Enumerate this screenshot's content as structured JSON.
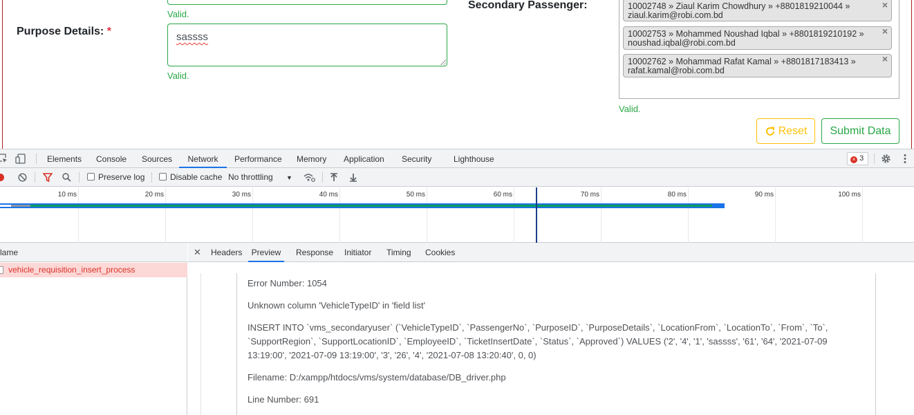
{
  "form": {
    "valid_text": "Valid.",
    "purpose_label": "Purpose Details:",
    "required_mark": "*",
    "purpose_value": "sassss",
    "secondary_label": "Secondary Passenger:",
    "passengers": [
      {
        "line1": "10002748 » Ziaul Karim Chowdhury » +8801819210044 »",
        "line2": "ziaul.karim@robi.com.bd",
        "remove": "×"
      },
      {
        "line1": "10002753 » Mohammed Noushad Iqbal » +8801819210192 »",
        "line2": "noushad.iqbal@robi.com.bd",
        "remove": "×"
      },
      {
        "line1": "10002762 » Mohammad Rafat Kamal » +8801817183413 »",
        "line2": "rafat.kamal@robi.com.bd",
        "remove": "×"
      }
    ],
    "reset_label": "Reset",
    "submit_label": "Submit Data",
    "colors": {
      "valid": "#28a745",
      "reset": "#ffc107",
      "required": "#dc3545"
    }
  },
  "devtools": {
    "tabs": [
      "Elements",
      "Console",
      "Sources",
      "Network",
      "Performance",
      "Memory",
      "Application",
      "Security",
      "Lighthouse"
    ],
    "active_tab": "Network",
    "error_count": "3",
    "toolbar": {
      "preserve_log": "Preserve log",
      "disable_cache": "Disable cache",
      "throttling": "No throttling"
    },
    "timeline_ticks": [
      "10 ms",
      "20 ms",
      "30 ms",
      "40 ms",
      "50 ms",
      "60 ms",
      "70 ms",
      "80 ms",
      "90 ms",
      "100 ms"
    ],
    "request_list": {
      "header": "lame",
      "rows": [
        "vehicle_requisition_insert_process"
      ]
    },
    "detail_tabs": [
      "Headers",
      "Preview",
      "Response",
      "Initiator",
      "Timing",
      "Cookies"
    ],
    "active_detail_tab": "Preview",
    "preview": {
      "error_number": "Error Number: 1054",
      "message": "Unknown column 'VehicleTypeID' in 'field list'",
      "query": "INSERT INTO `vms_secondaryuser` (`VehicleTypeID`, `PassengerNo`, `PurposeID`, `PurposeDetails`, `LocationFrom`, `LocationTo`, `From`, `To`, `SupportRegion`, `SupportLocationID`, `EmployeeID`, `TicketInsertDate`, `Status`, `Approved`) VALUES ('2', '4', '1', 'sassss', '61', '64', '2021-07-09 13:19:00', '2021-07-09 13:19:00', '3', '26', '4', '2021-07-08 13:20:40', 0, 0)",
      "filename": "Filename: D:/xampp/htdocs/vms/system/database/DB_driver.php",
      "line_number": "Line Number: 691"
    }
  }
}
